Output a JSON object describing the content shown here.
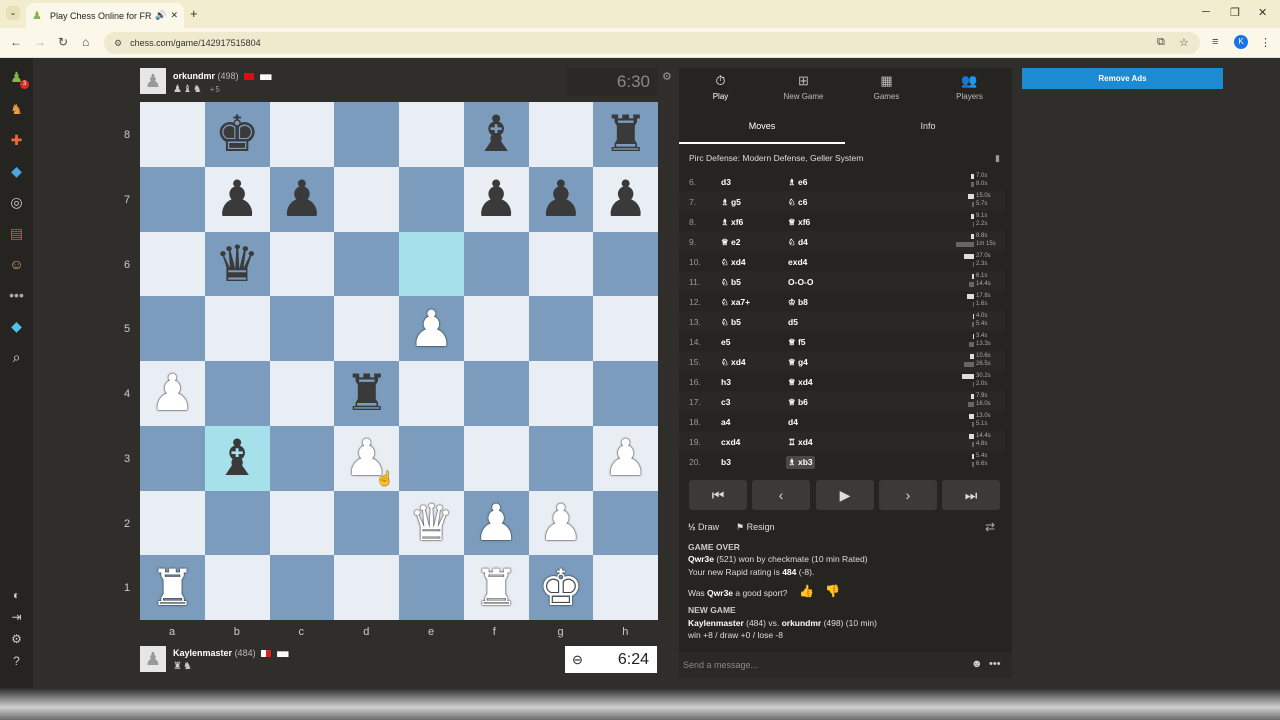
{
  "browser": {
    "tab_title": "Play Chess Online for FREE",
    "url": "chess.com/game/142917515804",
    "profile_initial": "K"
  },
  "sidebar": {
    "badge": "3"
  },
  "top_player": {
    "name": "orkundmr",
    "rating": "(498)",
    "captured": "♟♝♞",
    "advantage": "+5",
    "clock": "6:30"
  },
  "bottom_player": {
    "name": "Kaylenmaster",
    "rating": "(484)",
    "captured": "♜♞",
    "clock": "6:24"
  },
  "board": {
    "files": [
      "a",
      "b",
      "c",
      "d",
      "e",
      "f",
      "g",
      "h"
    ],
    "ranks": [
      "8",
      "7",
      "6",
      "5",
      "4",
      "3",
      "2",
      "1"
    ],
    "rows": [
      [
        "",
        "bK",
        "",
        "",
        "",
        "bB",
        "",
        "bR"
      ],
      [
        "",
        "bP",
        "bP",
        "",
        "",
        "bP",
        "bP",
        "bP"
      ],
      [
        "",
        "bQ",
        "",
        "",
        "",
        "",
        "",
        ""
      ],
      [
        "",
        "",
        "",
        "",
        "wP",
        "",
        "",
        ""
      ],
      [
        "wP",
        "",
        "",
        "bR",
        "",
        "",
        "",
        ""
      ],
      [
        "",
        "bB",
        "",
        "wP",
        "",
        "",
        "",
        "wP"
      ],
      [
        "",
        "",
        "",
        "",
        "wQ",
        "wP",
        "wP",
        ""
      ],
      [
        "wR",
        "",
        "",
        "",
        "",
        "wR",
        "wK",
        ""
      ]
    ],
    "highlights": [
      "e6",
      "b3"
    ]
  },
  "panel": {
    "tabs": [
      {
        "label": "Play",
        "icon": "⏱"
      },
      {
        "label": "New Game",
        "icon": "⊞"
      },
      {
        "label": "Games",
        "icon": "▦"
      },
      {
        "label": "Players",
        "icon": "👥"
      }
    ],
    "subtabs": [
      "Moves",
      "Info"
    ],
    "opening": "Pirc Defense: Modern Defense, Geller System"
  },
  "moves": [
    {
      "n": "6.",
      "w": "d3",
      "b": "♗ e6",
      "tw": "7.0s",
      "tb": "8.0s",
      "bw": 3,
      "bb": 3
    },
    {
      "n": "7.",
      "w": "♗ g5",
      "b": "♘ c6",
      "tw": "15.0s",
      "tb": "5.7s",
      "bw": 6,
      "bb": 2
    },
    {
      "n": "8.",
      "w": "♗ xf6",
      "b": "♕ xf6",
      "tw": "9.1s",
      "tb": "2.2s",
      "bw": 3,
      "bb": 1
    },
    {
      "n": "9.",
      "w": "♕ e2",
      "b": "♘ d4",
      "tw": "8.8s",
      "tb": "1m 15s",
      "bw": 3,
      "bb": 18
    },
    {
      "n": "10.",
      "w": "♘ xd4",
      "b": "exd4",
      "tw": "27.0s",
      "tb": "2.3s",
      "bw": 10,
      "bb": 1
    },
    {
      "n": "11.",
      "w": "♘ b5",
      "b": "O-O-O",
      "tw": "6.1s",
      "tb": "14.4s",
      "bw": 2,
      "bb": 5
    },
    {
      "n": "12.",
      "w": "♘ xa7+",
      "b": "♔ b8",
      "tw": "17.8s",
      "tb": "1.6s",
      "bw": 7,
      "bb": 1
    },
    {
      "n": "13.",
      "w": "♘ b5",
      "b": "d5",
      "tw": "4.0s",
      "tb": "5.4s",
      "bw": 1,
      "bb": 2
    },
    {
      "n": "14.",
      "w": "e5",
      "b": "♕ f5",
      "tw": "3.4s",
      "tb": "13.3s",
      "bw": 1,
      "bb": 5
    },
    {
      "n": "15.",
      "w": "♘ xd4",
      "b": "♕ g4",
      "tw": "10.6s",
      "tb": "26.5s",
      "bw": 4,
      "bb": 10
    },
    {
      "n": "16.",
      "w": "h3",
      "b": "♕ xd4",
      "tw": "30.2s",
      "tb": "2.0s",
      "bw": 12,
      "bb": 1
    },
    {
      "n": "17.",
      "w": "c3",
      "b": "♕ b6",
      "tw": "7.9s",
      "tb": "16.0s",
      "bw": 3,
      "bb": 6
    },
    {
      "n": "18.",
      "w": "a4",
      "b": "d4",
      "tw": "13.0s",
      "tb": "5.1s",
      "bw": 5,
      "bb": 2
    },
    {
      "n": "19.",
      "w": "cxd4",
      "b": "♖ xd4",
      "tw": "14.4s",
      "tb": "4.8s",
      "bw": 5,
      "bb": 2
    },
    {
      "n": "20.",
      "w": "b3",
      "b": "♗ xb3",
      "tw": "5.4s",
      "tb": "6.6s",
      "bw": 2,
      "bb": 2
    }
  ],
  "controls": {
    "draw": "Draw",
    "resign": "Resign"
  },
  "chat": {
    "game_over": "GAME OVER",
    "winner": "Qwr3e",
    "win_text": " (521) won by checkmate (10 min Rated)",
    "rating_prefix": "Your new Rapid rating is ",
    "rating_value": "484",
    "rating_suffix": " (-8).",
    "sport_prefix": "Was ",
    "sport_name": "Qwr3e",
    "sport_suffix": " a good sport?",
    "new_game": "NEW GAME",
    "ng_p1": "Kaylenmaster",
    "ng_mid": " (484) vs. ",
    "ng_p2": "orkundmr",
    "ng_tail": " (498) (10 min)",
    "ng_stakes": "win +8 / draw +0 / lose -8",
    "placeholder": "Send a message..."
  },
  "ads": {
    "remove": "Remove Ads"
  }
}
